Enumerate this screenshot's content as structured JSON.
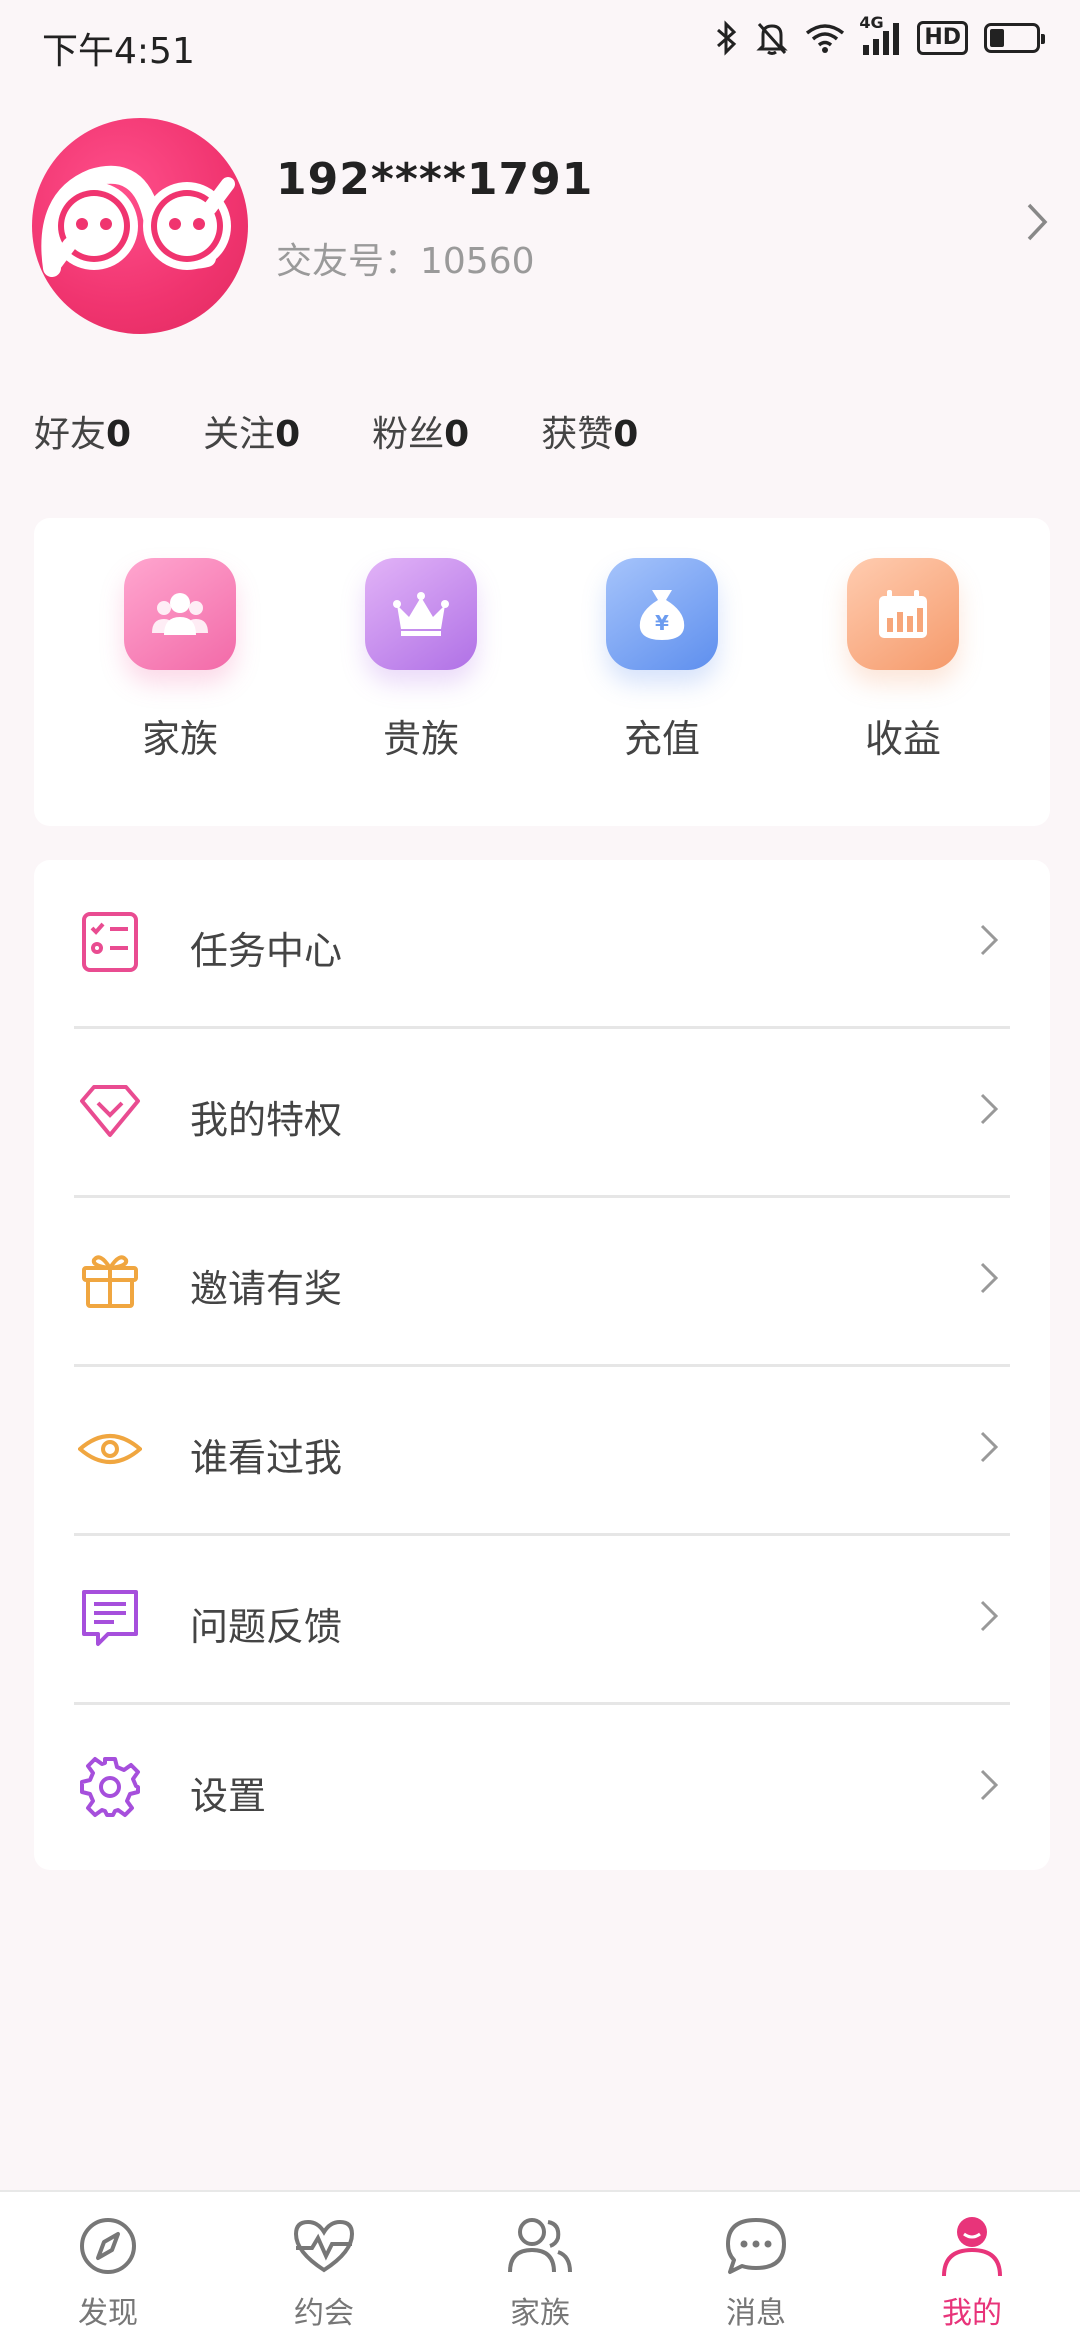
{
  "status_bar": {
    "time": "下午4:51",
    "network": "4G",
    "hd": "HD"
  },
  "profile": {
    "username": "192****1791",
    "friend_id": "交友号：10560"
  },
  "stats": [
    {
      "label": "好友",
      "value": "0"
    },
    {
      "label": "关注",
      "value": "0"
    },
    {
      "label": "粉丝",
      "value": "0"
    },
    {
      "label": "获赞",
      "value": "0"
    }
  ],
  "quick_actions": [
    {
      "label": "家族",
      "icon": "family-icon",
      "color": "#f777b0"
    },
    {
      "label": "贵族",
      "icon": "crown-icon",
      "color": "#b37be8"
    },
    {
      "label": "充值",
      "icon": "money-bag-icon",
      "color": "#6c9cf0"
    },
    {
      "label": "收益",
      "icon": "earnings-icon",
      "color": "#f7a67a"
    }
  ],
  "menu": [
    {
      "label": "任务中心",
      "icon": "task-list-icon",
      "color": "#e94c91"
    },
    {
      "label": "我的特权",
      "icon": "diamond-icon",
      "color": "#e94c91"
    },
    {
      "label": "邀请有奖",
      "icon": "gift-icon",
      "color": "#f0a640"
    },
    {
      "label": "谁看过我",
      "icon": "eye-icon",
      "color": "#f0a640"
    },
    {
      "label": "问题反馈",
      "icon": "feedback-icon",
      "color": "#a64fdc"
    },
    {
      "label": "设置",
      "icon": "gear-icon",
      "color": "#a64fdc"
    }
  ],
  "bottom_nav": [
    {
      "label": "发现",
      "icon": "compass-icon",
      "active": false
    },
    {
      "label": "约会",
      "icon": "heartbeat-icon",
      "active": false
    },
    {
      "label": "家族",
      "icon": "people-icon",
      "active": false
    },
    {
      "label": "消息",
      "icon": "chat-icon",
      "active": false
    },
    {
      "label": "我的",
      "icon": "profile-icon",
      "active": true
    }
  ],
  "colors": {
    "accent": "#e8347a",
    "background": "#fbf6f8"
  }
}
